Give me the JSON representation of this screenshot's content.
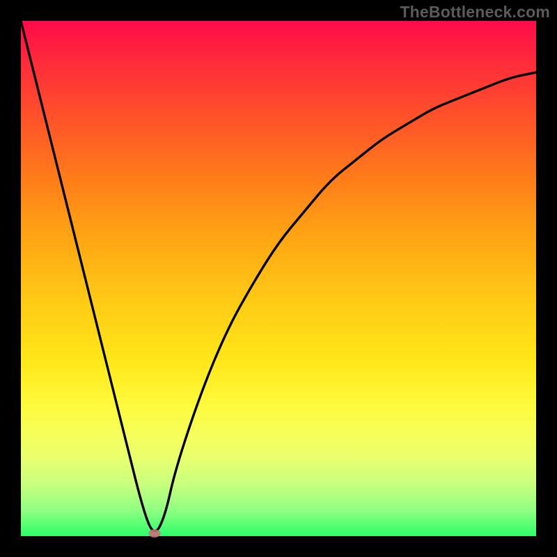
{
  "watermark": "TheBottleneck.com",
  "chart_data": {
    "type": "line",
    "title": "",
    "xlabel": "",
    "ylabel": "",
    "xlim": [
      0,
      100
    ],
    "ylim": [
      0,
      100
    ],
    "x": [
      0,
      5,
      10,
      15,
      20,
      24,
      26,
      28,
      30,
      35,
      40,
      45,
      50,
      55,
      60,
      65,
      70,
      75,
      80,
      85,
      90,
      95,
      100
    ],
    "values": [
      100,
      80,
      60,
      40,
      20,
      4,
      0,
      4,
      13,
      28,
      40,
      49,
      57,
      63,
      69,
      73,
      77,
      80,
      83,
      85,
      87,
      89,
      90
    ],
    "min_point": {
      "x": 26,
      "y": 0
    },
    "background_gradient": [
      "#ff0a4a",
      "#ffe71a",
      "#2cff6a"
    ],
    "marker": {
      "x": 26,
      "y": 0.5,
      "color": "#cc6d78"
    }
  }
}
